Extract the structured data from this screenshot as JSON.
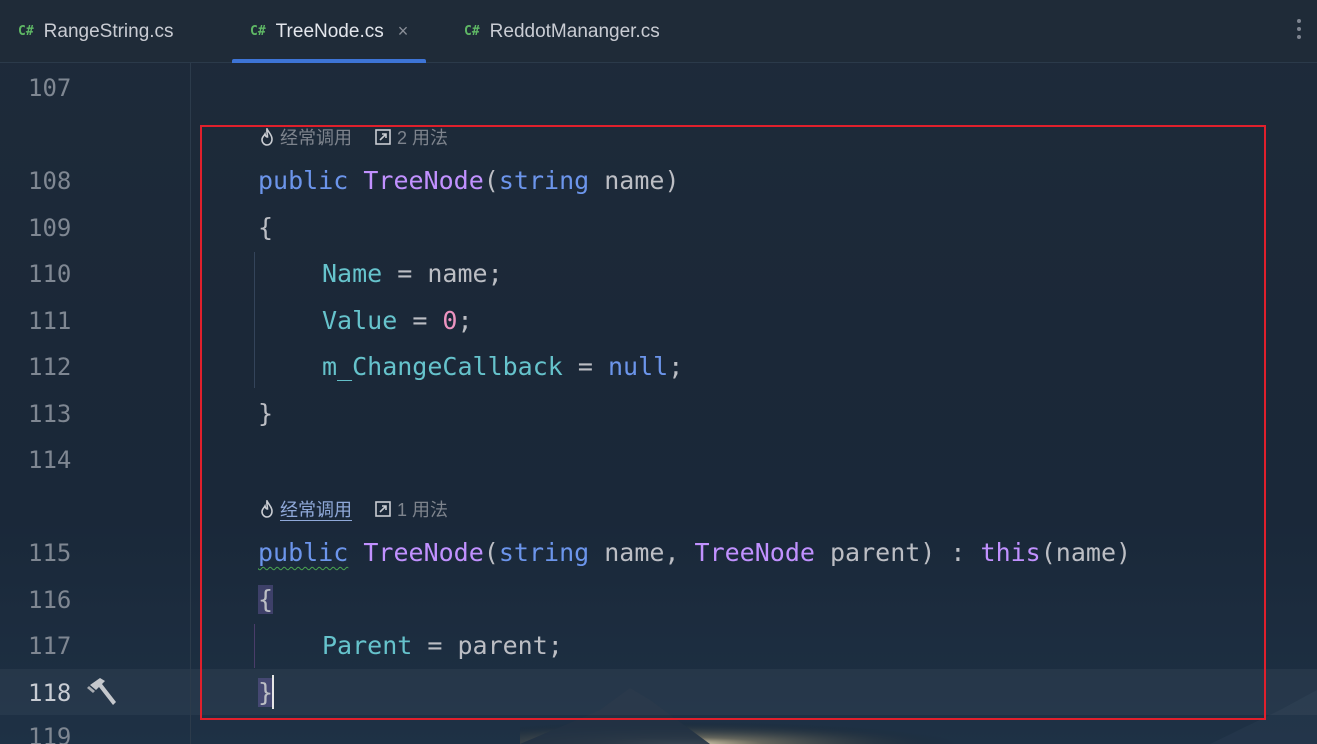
{
  "tabs": [
    {
      "icon": "C#",
      "label": "RangeString.cs",
      "active": false
    },
    {
      "icon": "C#",
      "label": "TreeNode.cs",
      "active": true,
      "close": "×"
    },
    {
      "icon": "C#",
      "label": "ReddotMananger.cs",
      "active": false
    }
  ],
  "line_numbers": [
    "107",
    "108",
    "109",
    "110",
    "111",
    "112",
    "113",
    "114",
    "115",
    "116",
    "117",
    "118",
    "119"
  ],
  "hints": [
    {
      "frequent": "经常调用",
      "usages": "2 用法"
    },
    {
      "frequent": "经常调用",
      "usages": "1 用法"
    }
  ],
  "code": {
    "l108": {
      "kw": "public",
      "name": "TreeNode",
      "open": "(",
      "ptype": "string",
      "pname": " name",
      "close": ")"
    },
    "l109": "{",
    "l110": {
      "field": "Name",
      "rest": " = name;"
    },
    "l111": {
      "field": "Value",
      "eq": " = ",
      "num": "0",
      "end": ";"
    },
    "l112": {
      "field": "m_ChangeCallback",
      "eq": " = ",
      "kw": "null",
      "end": ";"
    },
    "l113": "}",
    "l115": {
      "kw": "public",
      "name": "TreeNode",
      "open": "(",
      "ptype": "string",
      "pname": " name, ",
      "ptype2": "TreeNode",
      "pname2": " parent) : ",
      "this": "this",
      "rest": "(name)"
    },
    "l116": "{",
    "l117": {
      "field": "Parent",
      "rest": " = parent;"
    },
    "l118": "}"
  },
  "colors": {
    "keyword": "#6c95eb",
    "type": "#c191ff",
    "field": "#66c3cc",
    "number": "#ed94c0",
    "highlight_box": "#e0202c",
    "active_tab_underline": "#3d74d6"
  }
}
